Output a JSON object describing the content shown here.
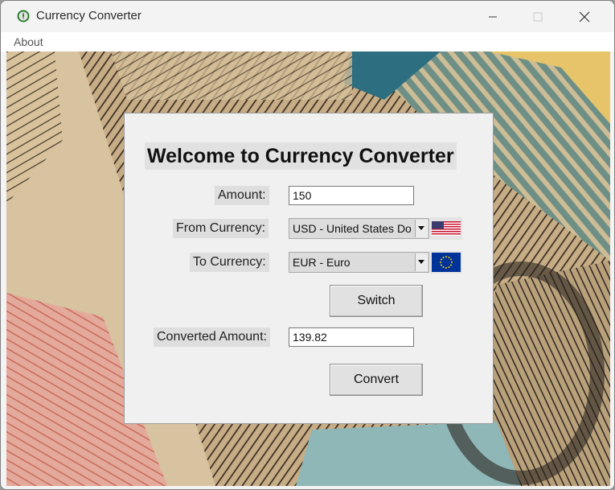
{
  "window": {
    "title": "Currency Converter",
    "controls": {
      "minimize_icon": "minimize-icon",
      "maximize_icon": "maximize-icon",
      "close_icon": "close-icon"
    }
  },
  "menubar": {
    "items": [
      {
        "label": "About"
      }
    ]
  },
  "form": {
    "heading": "Welcome to Currency Converter",
    "amount_label": "Amount:",
    "amount_value": "150",
    "from_label": "From Currency:",
    "from_value": "USD - United States Do",
    "from_flag": "us-flag-icon",
    "to_label": "To Currency:",
    "to_value": "EUR - Euro",
    "to_flag": "eu-flag-icon",
    "switch_label": "Switch",
    "converted_label": "Converted Amount:",
    "converted_value": "139.82",
    "convert_label": "Convert"
  },
  "colors": {
    "panel_bg": "#f0f0f0",
    "label_bg": "#dedede",
    "button_bg": "#e1e1e1"
  }
}
